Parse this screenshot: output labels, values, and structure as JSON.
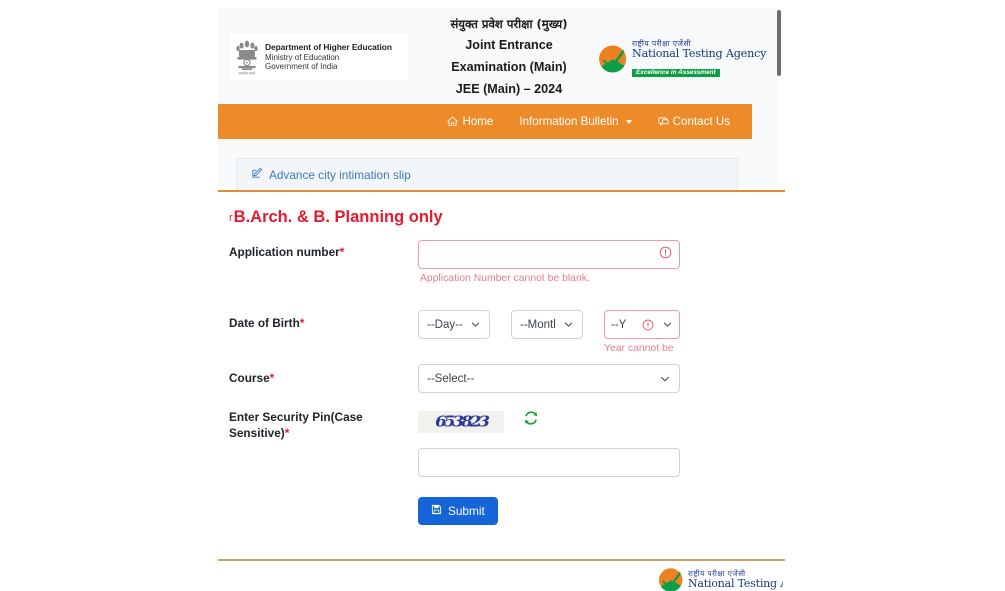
{
  "header": {
    "gov_line1": "Department of Higher Education",
    "gov_line2": "Ministry of Education",
    "gov_line3": "Government of India",
    "title_hindi": "संयुक्त प्रवेश परीक्षा (मुख्य)",
    "title_line1": "Joint Entrance",
    "title_line2": "Examination (Main)",
    "title_line3": "JEE (Main) – 2024",
    "nta_hindi": "राष्ट्रीय परीक्षा एजेंसी",
    "nta_english": "National Testing Agency",
    "nta_tagline": "Excellence in Assessment"
  },
  "nav": {
    "items": [
      {
        "label": "Home",
        "icon": "home-icon",
        "has_caret": false
      },
      {
        "label": "Information Bulletin",
        "icon": "",
        "has_caret": true
      },
      {
        "label": "Contact Us",
        "icon": "contact-icon",
        "has_caret": false
      }
    ]
  },
  "tab": {
    "label": "Advance city intimation slip",
    "icon": "edit-square-icon"
  },
  "form": {
    "title_lead": "r",
    "title": "B.Arch. & B. Planning only",
    "application_number": {
      "label": "Application number",
      "required": "*",
      "value": "",
      "placeholder": "",
      "error": "Application Number cannot be blank.",
      "invalid": true
    },
    "date_of_birth": {
      "label": "Date of Birth",
      "required": "*",
      "day": "--Day--",
      "month": "--Montl",
      "year": "--Y",
      "error": "Year cannot be",
      "year_invalid": true
    },
    "course": {
      "label": "Course",
      "required": "*",
      "value": "--Select--"
    },
    "security_pin": {
      "label_line1": "Enter Security Pin(Case",
      "label_line2": "Sensitive)",
      "required": "*",
      "captcha_text": "653823",
      "refresh_icon": "refresh-icon",
      "value": "",
      "placeholder": ""
    },
    "submit": {
      "label": "Submit",
      "icon": "save-icon",
      "color": "#1565d8"
    }
  },
  "footer": {
    "nta_hindi": "राष्ट्रीय परीक्षा एजेंसी",
    "nta_english": "National Testing Agency"
  },
  "colors": {
    "nav_orange": "#ed8b2b",
    "title_red": "#e8192c",
    "link_blue": "#3a7bbf",
    "submit_blue": "#1565d8",
    "error_pink": "#e4808b",
    "nta_green": "#0e9e45"
  }
}
